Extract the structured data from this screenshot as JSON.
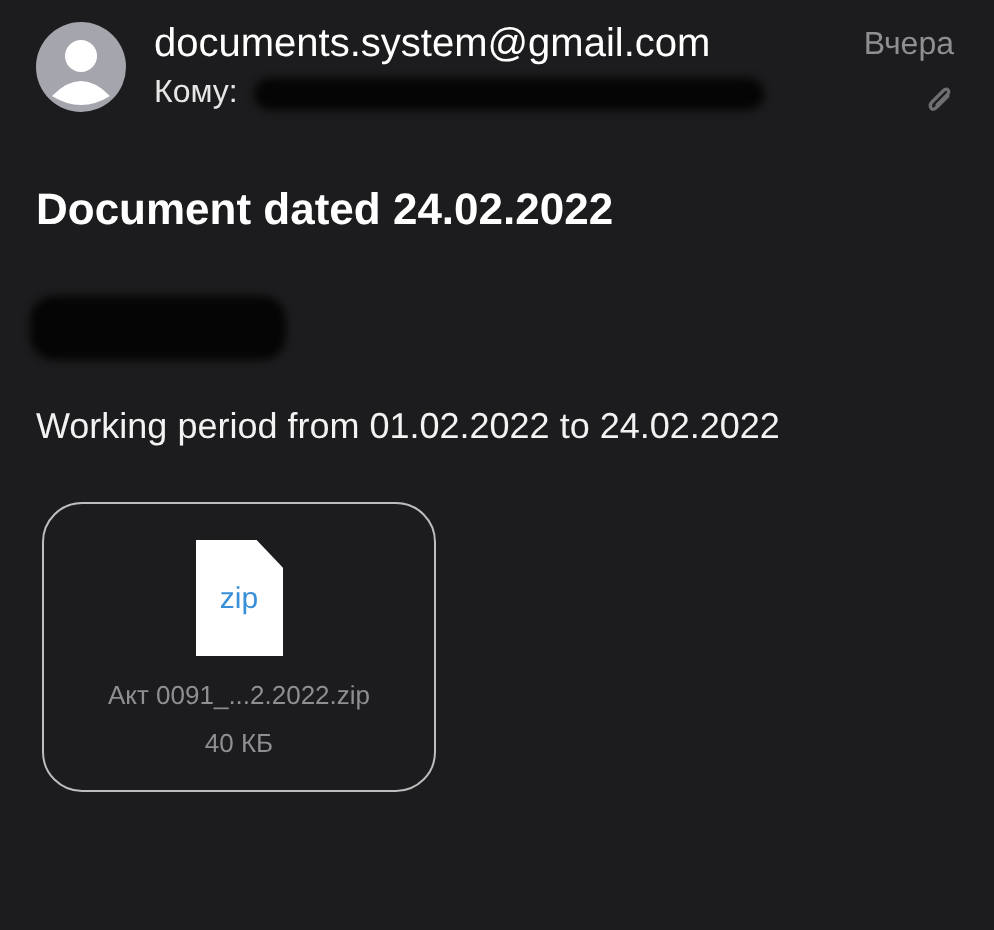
{
  "sender": {
    "email": "documents.system@gmail.com",
    "to_label": "Кому:",
    "date": "Вчера",
    "has_attachment": true
  },
  "subject": "Document dated 24.02.2022",
  "body": "Working period from 01.02.2022 to 24.02.2022",
  "attachment": {
    "type_label": "zip",
    "filename": "Акт 0091_...2.2022.zip",
    "size": "40 КБ"
  }
}
